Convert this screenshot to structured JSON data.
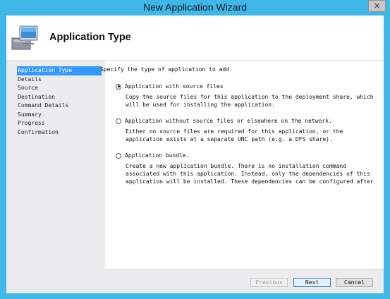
{
  "window": {
    "title": "New Application Wizard",
    "close_glyph": "×"
  },
  "header": {
    "title": "Application Type",
    "icon": "computer-icon"
  },
  "nav": {
    "items": [
      {
        "label": "Application Type",
        "active": true
      },
      {
        "label": "Details"
      },
      {
        "label": "Source"
      },
      {
        "label": "Destination"
      },
      {
        "label": "Command Details"
      },
      {
        "label": "Summary"
      },
      {
        "label": "Progress"
      },
      {
        "label": "Confirmation"
      }
    ]
  },
  "content": {
    "intro": "Specify the type of application to add.",
    "options": [
      {
        "label": "Application with source files",
        "checked": true,
        "description": "Copy the source files for this application to the deployment share, which will be used for installing the application."
      },
      {
        "label": "Application without source files or elsewhere on the network.",
        "checked": false,
        "description": "Either no source files are required for this application, or the application exists at a separate UNC path (e.g. a DFS share)."
      },
      {
        "label": "Application bundle.",
        "checked": false,
        "description": "Create a new application bundle.  There is no installation command associated with this application.  Instead, only the dependencies of this application will be installed.  These dependencies can be configured after"
      }
    ]
  },
  "buttons": {
    "previous": "Previous",
    "next": "Next",
    "cancel": "Cancel"
  },
  "colors": {
    "titlebar": "#3fb7e8",
    "selection": "#3399ff",
    "panel_bg": "#ecebed"
  }
}
